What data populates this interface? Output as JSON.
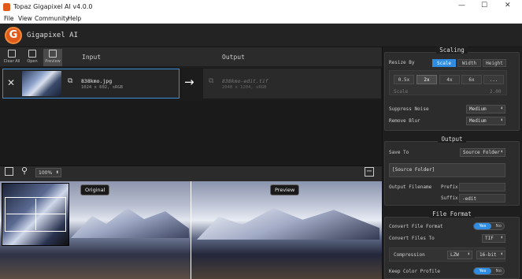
{
  "window": {
    "title": "Topaz Gigapixel AI v4.0.0",
    "controls": [
      "—",
      "☐",
      "✕"
    ]
  },
  "menu": [
    "File",
    "View",
    "Community",
    "Help"
  ],
  "app": {
    "logo_letter": "G",
    "name": "Gigapixel AI"
  },
  "toolbar": {
    "clear_all": "Clear All",
    "open": "Open",
    "preview": "Preview",
    "input_header": "Input",
    "output_header": "Output"
  },
  "file": {
    "name": "838kmo.jpg",
    "info": "1024 x 602, sRGB",
    "output_name": "838kmo-edit.tif",
    "output_info": "2048 x 1204, sRGB"
  },
  "preview": {
    "zoom": "100%",
    "original_label": "Original",
    "preview_label": "Preview"
  },
  "scaling": {
    "header": "Scaling",
    "resize_by_label": "Resize By",
    "resize_options": [
      "Scale",
      "Width",
      "Height"
    ],
    "resize_selected": "Scale",
    "scale_options": [
      "0.5x",
      "2x",
      "4x",
      "6x",
      "..."
    ],
    "scale_selected": "2x",
    "scale_label": "Scale",
    "scale_value": "2.00",
    "suppress_noise_label": "Suppress Noise",
    "suppress_noise_value": "Medium",
    "remove_blur_label": "Remove Blur",
    "remove_blur_value": "Medium"
  },
  "output": {
    "header": "Output",
    "save_to_label": "Save To",
    "save_to_value": "Source Folder",
    "source_folder_value": "[Source Folder]",
    "filename_label": "Output Filename",
    "prefix_label": "Prefix",
    "prefix_value": "",
    "suffix_label": "Suffix",
    "suffix_value": "-edit"
  },
  "file_format": {
    "header": "File Format",
    "convert_profile_label": "Convert File Format",
    "convert_profile_on": "Yes",
    "convert_profile_off": "No",
    "convert_to_label": "Convert Files To",
    "convert_to_value": "TIF",
    "compression_label": "Compression",
    "compression_value": "LZW",
    "bits_value": "16-bit",
    "keep_color_label": "Keep Color Profile",
    "keep_color_on": "Yes",
    "keep_color_off": "No"
  },
  "colors": {
    "accent": "#2f8ce0",
    "logo": "#e05a1a"
  }
}
